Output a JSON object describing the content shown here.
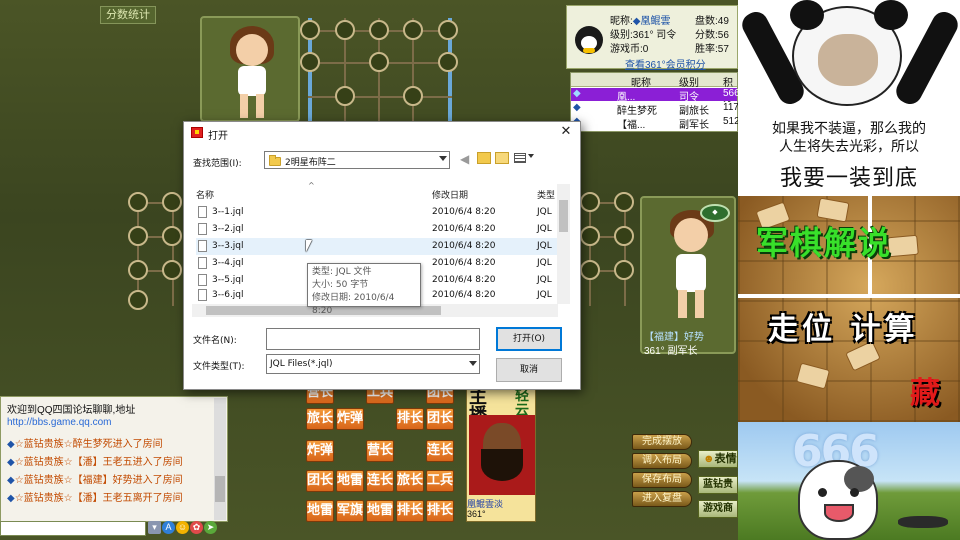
{
  "game": {
    "score_button": "分数统计",
    "player_info": {
      "nick_label": "昵称:",
      "nick": "凰鲲雲",
      "games_label": "盘数:",
      "games": "49",
      "level_label": "级别:",
      "level": "361° 司令",
      "score_label": "分数:",
      "score": "56",
      "coins_label": "游戏币:",
      "coins": "0",
      "win_label": "胜率:",
      "win": "57",
      "vip_link": "查看361°会员积分"
    },
    "player_list": {
      "columns": [
        "昵称",
        "级别",
        "积分"
      ],
      "rows": [
        {
          "name": "凰...",
          "level": "司令",
          "score": "566",
          "selected": true
        },
        {
          "name": "醉生梦死",
          "level": "副旅长",
          "score": "117",
          "selected": false
        },
        {
          "name": "【福...",
          "level": "副军长",
          "score": "512",
          "selected": false
        }
      ]
    },
    "right_player": {
      "name": "【福建】好势",
      "rank": "361° 副军长"
    },
    "host_player": {
      "name": "凰鲲雲淡",
      "rank": "361°",
      "banner_left": "主播",
      "banner_right": "轻云淡"
    },
    "tiles": {
      "row0": [
        "营长",
        "工兵",
        "团长"
      ],
      "row1": [
        "旅长",
        "炸弹",
        "排长",
        "团长"
      ],
      "row2": [
        "炸弹",
        "营长",
        "连长"
      ],
      "row3": [
        "团长",
        "地雷",
        "连长",
        "旅长",
        "工兵"
      ],
      "row4": [
        "地雷",
        "军旗",
        "地雷",
        "排长",
        "排长"
      ]
    },
    "side_buttons": [
      "完成摆放",
      "调入布局",
      "保存布局",
      "进入复盘"
    ],
    "tool_buttons": [
      "表情",
      "蓝钻贵",
      "游戏商"
    ]
  },
  "chat": {
    "lines": [
      {
        "type": "sys",
        "text": "欢迎到QQ四国论坛聊聊,地址"
      },
      {
        "type": "lnk",
        "text": "http://bbs.game.qq.com"
      },
      {
        "type": "msg",
        "text": "☆蓝钻贵族☆醉生梦死进入了房间"
      },
      {
        "type": "msg",
        "text": "☆蓝钻贵族☆【潘】王老五进入了房间"
      },
      {
        "type": "msg",
        "text": "☆蓝钻贵族☆【福建】好势进入了房间"
      },
      {
        "type": "msg",
        "text": "☆蓝钻贵族☆【潘】王老五离开了房间"
      }
    ],
    "input_value": ""
  },
  "dialog": {
    "title": "打开",
    "look_in_label": "查找范围(I):",
    "look_in_value": "2明星布阵二",
    "columns": {
      "name": "名称",
      "date": "修改日期",
      "type": "类型"
    },
    "files": [
      {
        "name": "3--1.jql",
        "date": "2010/6/4 8:20",
        "type": "JQL"
      },
      {
        "name": "3--2.jql",
        "date": "2010/6/4 8:20",
        "type": "JQL"
      },
      {
        "name": "3--3.jql",
        "date": "2010/6/4 8:20",
        "type": "JQL"
      },
      {
        "name": "3--4.jql",
        "date": "2010/6/4 8:20",
        "type": "JQL"
      },
      {
        "name": "3--5.jql",
        "date": "2010/6/4 8:20",
        "type": "JQL"
      },
      {
        "name": "3--6.jql",
        "date": "2010/6/4 8:20",
        "type": "JQL"
      }
    ],
    "tooltip": {
      "type_line": "类型: JQL 文件",
      "size_line": "大小: 50 字节",
      "date_line": "修改日期: 2010/6/4 8:20"
    },
    "filename_label": "文件名(N):",
    "filename_value": "",
    "filetype_label": "文件类型(T):",
    "filetype_value": "JQL Files(*.jql)",
    "open_button": "打开(O)",
    "cancel_button": "取消"
  },
  "memes": {
    "panda_line1": "如果我不装逼，那么我的",
    "panda_line2": "人生将失去光彩，所以",
    "panda_line3": "我要一装到底",
    "junqi_title": "军棋解说",
    "junqi_sub": "走位 计算",
    "junqi_sub2": "藏",
    "number": "666"
  },
  "colors": {
    "board_green": "#3f4a22",
    "tile_orange": "#e07a28",
    "selected_row": "#8b1fd6",
    "chat_msg": "#c24a00",
    "meme_green": "#38e02a"
  }
}
